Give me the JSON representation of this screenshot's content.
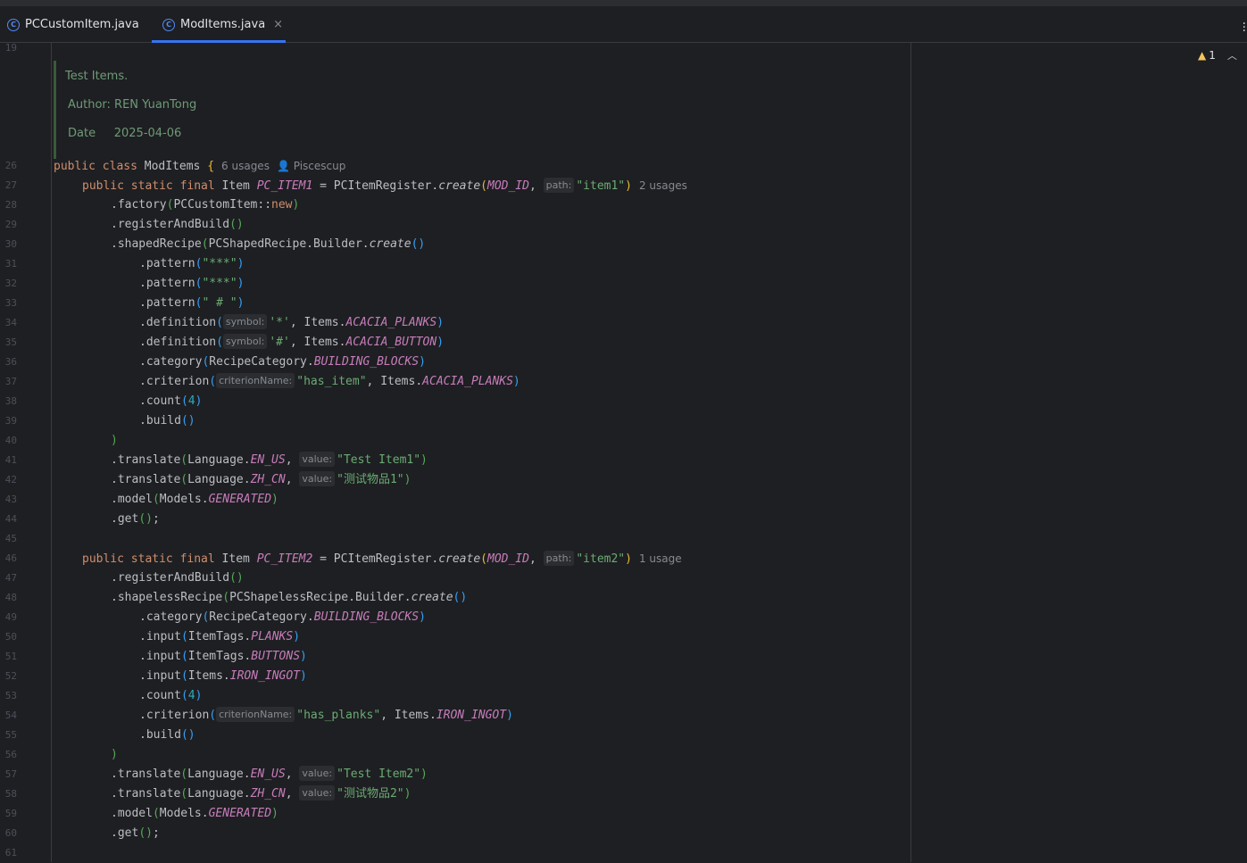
{
  "tabs": [
    {
      "label": "PCCustomItem.java",
      "icon": "class-icon",
      "active": false
    },
    {
      "label": "ModItems.java",
      "icon": "class-icon",
      "active": true,
      "close": "×"
    }
  ],
  "warnings": {
    "count": "1",
    "icon": "warning-icon"
  },
  "doc_comment": {
    "line1": "Test Items.",
    "line2": "Author: REN YuanTong",
    "line3": "Date     2025-04-06"
  },
  "line_numbers": [
    "19",
    "26",
    "27",
    "28",
    "29",
    "30",
    "31",
    "32",
    "33",
    "34",
    "35",
    "36",
    "37",
    "38",
    "39",
    "40",
    "41",
    "42",
    "43",
    "44",
    "45",
    "46",
    "47",
    "48",
    "49",
    "50",
    "51",
    "52",
    "53",
    "54",
    "55",
    "56",
    "57",
    "58",
    "59",
    "60",
    "61"
  ],
  "hints": {
    "class_usages": "6 usages",
    "author": "Piscescup",
    "item1_usages": "2 usages",
    "item2_usages": "1 usage",
    "path": "path:",
    "symbol": "symbol:",
    "criterion": "criterionName:",
    "value": "value:"
  },
  "code": {
    "public_class": "public class ",
    "class_name": "ModItems",
    "brace_open": " {",
    "psf": "public static final ",
    "item_type": "Item ",
    "item1": "PC_ITEM1",
    "item2": "PC_ITEM2",
    "eq_register": " = PCItemRegister.",
    "create": "create",
    "mod_id": "MOD_ID",
    "comma": ", ",
    "str_item1": "\"item1\"",
    "str_item2": "\"item2\"",
    "factory": ".factory",
    "factory_arg": "PCCustomItem::",
    "new_kw": "new",
    "register_and_build": ".registerAndBuild",
    "shaped_recipe": ".shapedRecipe",
    "shaped_builder": "PCShapedRecipe.Builder.",
    "shapeless_recipe": ".shapelessRecipe",
    "shapeless_builder": "PCShapelessRecipe.Builder.",
    "pattern": ".pattern",
    "pattern1": "\"***\"",
    "pattern2": "\"***\"",
    "pattern3": "\" # \"",
    "definition": ".definition",
    "sym_star": "'*'",
    "sym_hash": "'#'",
    "items_prefix": ", Items.",
    "items_only": "Items.",
    "acacia_planks": "ACACIA_PLANKS",
    "acacia_button": "ACACIA_BUTTON",
    "category": ".category",
    "recipe_category": "RecipeCategory.",
    "building_blocks": "BUILDING_BLOCKS",
    "criterion": ".criterion",
    "has_item": "\"has_item\"",
    "has_planks": "\"has_planks\"",
    "count": ".count",
    "count_value": "4",
    "build": ".build",
    "translate": ".translate",
    "language": "Language.",
    "en_us": "EN_US",
    "zh_cn": "ZH_CN",
    "test_item1": "\"Test Item1\"",
    "test_item2": "\"Test Item2\"",
    "zh_item1": "\"测试物品1\"",
    "zh_item2": "\"测试物品2\"",
    "model": ".model",
    "models": "Models.",
    "generated": "GENERATED",
    "get": ".get",
    "semicolon": ";",
    "input": ".input",
    "item_tags": "ItemTags.",
    "planks": "PLANKS",
    "buttons": "BUTTONS",
    "iron_ingot": "IRON_INGOT",
    "lp": "(",
    "rp": ")"
  }
}
